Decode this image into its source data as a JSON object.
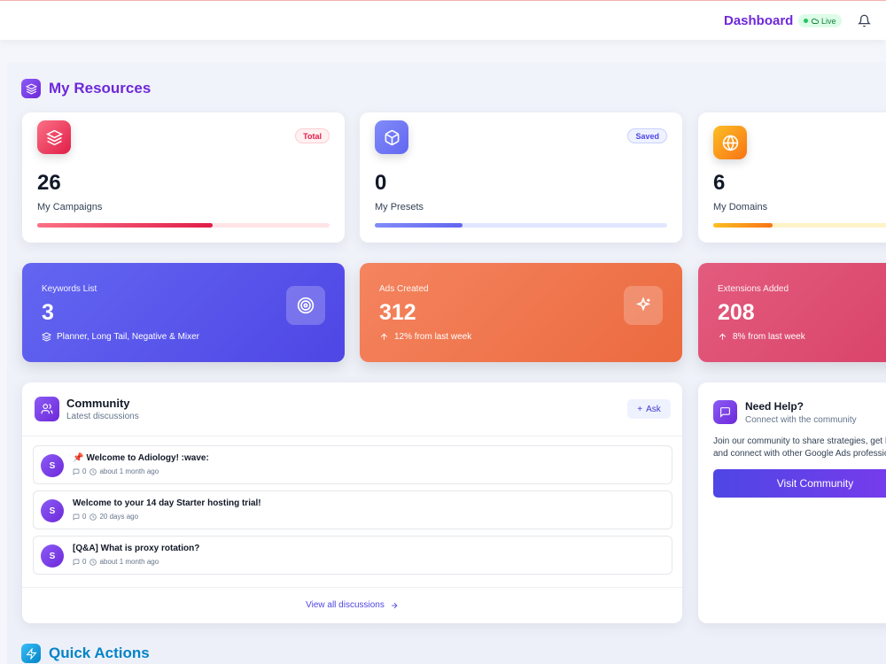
{
  "header": {
    "title": "Dashboard",
    "status": "Live"
  },
  "resources": {
    "title": "My Resources",
    "cards": [
      {
        "value": "26",
        "label": "My Campaigns",
        "badge": "Total",
        "progress": 0.6
      },
      {
        "value": "0",
        "label": "My Presets",
        "badge": "Saved",
        "progress": 0.3
      },
      {
        "value": "6",
        "label": "My Domains",
        "badge": "",
        "progress": 0.3
      }
    ]
  },
  "stats": [
    {
      "label": "Keywords List",
      "value": "3",
      "sub": "Planner, Long Tail, Negative & Mixer"
    },
    {
      "label": "Ads Created",
      "value": "312",
      "sub": "12% from last week"
    },
    {
      "label": "Extensions Added",
      "value": "208",
      "sub": "8% from last week"
    }
  ],
  "community": {
    "title": "Community",
    "subtitle": "Latest discussions",
    "ask_label": "Ask",
    "posts": [
      {
        "avatar": "S",
        "title": "Welcome to Adiology! :wave:",
        "comments": "0",
        "time": "about 1 month ago",
        "pinned": true
      },
      {
        "avatar": "S",
        "title": "Welcome to your 14 day Starter hosting trial!",
        "comments": "0",
        "time": "20 days ago",
        "pinned": false
      },
      {
        "avatar": "S",
        "title": "[Q&A] What is proxy rotation?",
        "comments": "0",
        "time": "about 1 month ago",
        "pinned": false
      }
    ],
    "view_all": "View all discussions"
  },
  "help": {
    "title": "Need Help?",
    "subtitle": "Connect with the community",
    "text": "Join our community to share strategies, get help and connect with other Google Ads professionals.",
    "button": "Visit Community"
  },
  "quick_actions": {
    "title": "Quick Actions"
  },
  "colors": {
    "brand": "#6d28d9",
    "campaigns": "#f43f5e",
    "presets": "#6366f1",
    "domains": "#f59e0b",
    "keywords_card": "#5b5bea",
    "ads_card": "#f07a52",
    "extensions_card": "#e0517a"
  }
}
